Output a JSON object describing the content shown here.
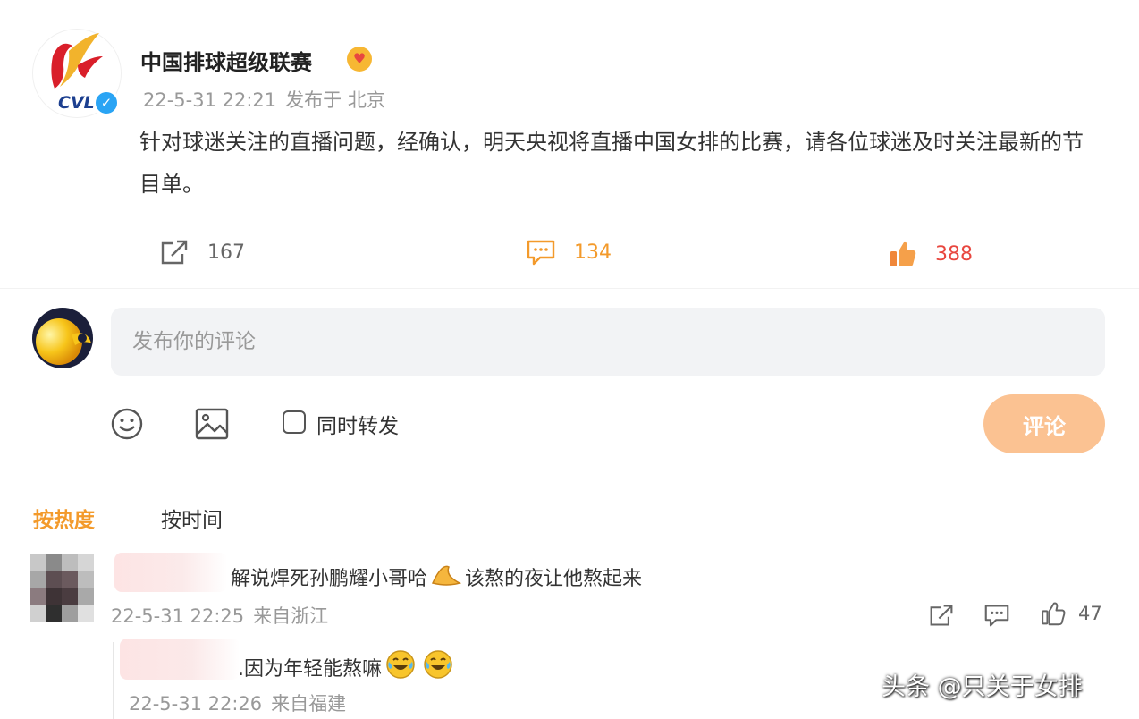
{
  "post": {
    "author": "中国排球超级联赛",
    "avatar_text": "CVL",
    "verified_mark": "✓",
    "badge_icon": "crown-heart-badge",
    "date": "22-5-31 22:21",
    "location": "发布于 北京",
    "content": "针对球迷关注的直播问题，经确认，明天央视将直播中国女排的比赛，请各位球迷及时关注最新的节目单。",
    "repost_count": "167",
    "comment_count": "134",
    "like_count": "388"
  },
  "composer": {
    "placeholder": "发布你的评论",
    "forward_label": "同时转发",
    "submit_label": "评论"
  },
  "sort": {
    "hot_label": "按热度",
    "time_label": "按时间"
  },
  "comments": [
    {
      "text_before": "解说焊死孙鹏耀小哥哈",
      "text_after": "该熬的夜让他熬起来",
      "date": "22-5-31 22:25",
      "location": "来自浙江",
      "like_count": "47",
      "reply": {
        "text": ".因为年轻能熬嘛",
        "date": "22-5-31 22:26",
        "location": "来自福建"
      }
    }
  ],
  "watermark": "头条 @只关于女排",
  "colors": {
    "accent_orange": "#f39a2b",
    "like_red": "#e8473f",
    "submit_disabled": "#fbc292",
    "meta_gray": "#999999",
    "verified_blue": "#2aa4f4"
  }
}
